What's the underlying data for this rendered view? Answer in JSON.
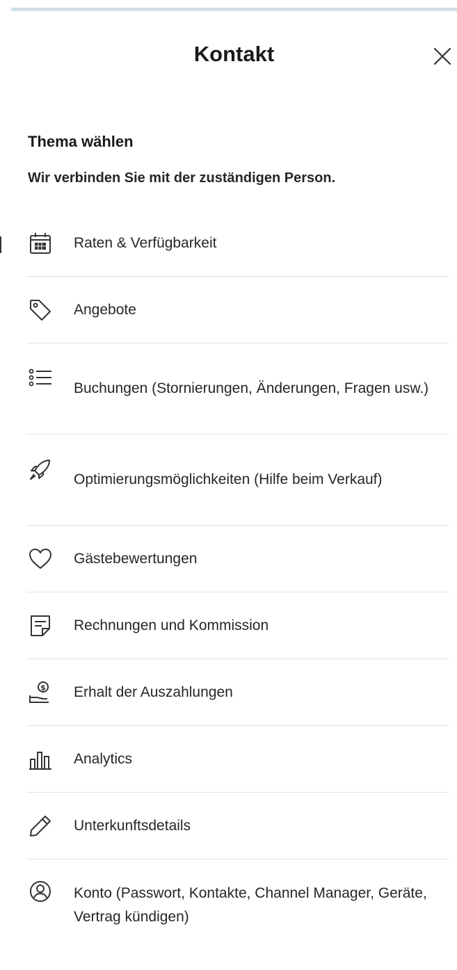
{
  "header": {
    "title": "Kontakt",
    "close_icon": "close-icon"
  },
  "intro": {
    "subtitle": "Thema wählen",
    "description": "Wir verbinden Sie mit der zuständigen Person."
  },
  "topics": [
    {
      "label": "Raten & Verfügbarkeit",
      "icon": "calendar-icon"
    },
    {
      "label": "Angebote",
      "icon": "tag-icon"
    },
    {
      "label": "Buchungen (Stornierungen, Änderungen, Fragen usw.)",
      "icon": "list-icon"
    },
    {
      "label": "Optimierungsmöglichkeiten (Hilfe beim Verkauf)",
      "icon": "rocket-icon"
    },
    {
      "label": "Gästebewertungen",
      "icon": "heart-icon"
    },
    {
      "label": "Rechnungen und Kommission",
      "icon": "invoice-icon"
    },
    {
      "label": "Erhalt der Auszahlungen",
      "icon": "payout-icon"
    },
    {
      "label": "Analytics",
      "icon": "bar-chart-icon"
    },
    {
      "label": "Unterkunftsdetails",
      "icon": "pencil-icon"
    },
    {
      "label": "Konto (Passwort, Kontakte, Channel Manager, Geräte, Vertrag kündigen)",
      "icon": "account-icon"
    }
  ],
  "colors": {
    "accent_border": "#cfe0e6",
    "text": "#262626",
    "divider": "#e2e2e2"
  }
}
